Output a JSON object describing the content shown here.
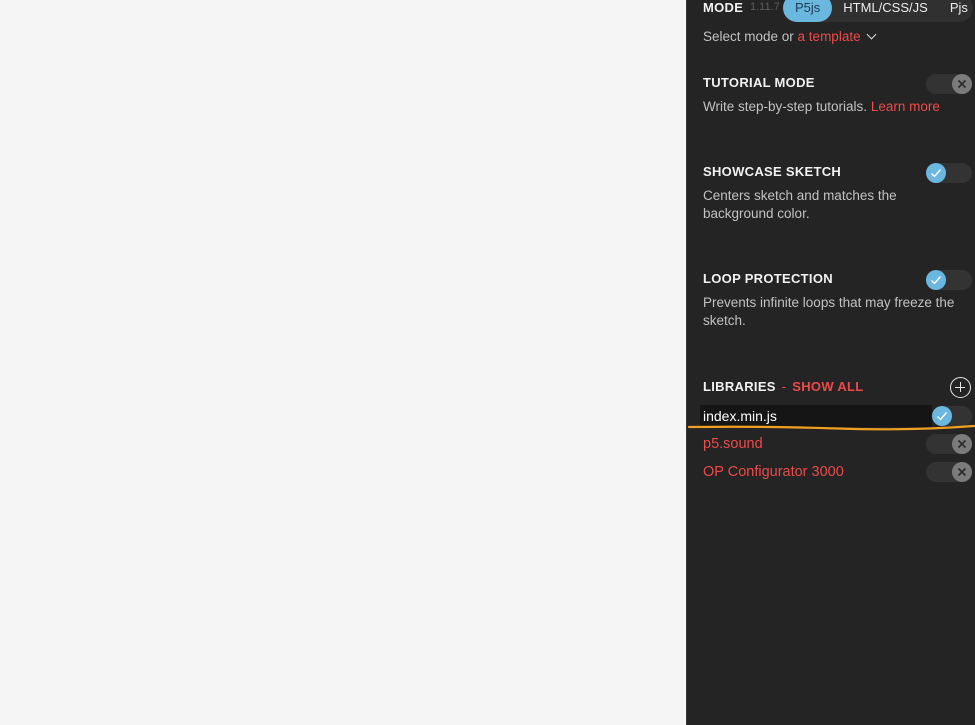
{
  "mode": {
    "title": "MODE",
    "version": "1.11.7",
    "options": [
      "P5js",
      "HTML/CSS/JS",
      "Pjs"
    ],
    "selected": "P5js",
    "subtitle_prefix": "Select mode or ",
    "subtitle_link": "a template"
  },
  "tutorial": {
    "title": "TUTORIAL MODE",
    "desc_prefix": "Write step-by-step tutorials. ",
    "desc_link": "Learn more",
    "enabled": false
  },
  "showcase": {
    "title": "SHOWCASE SKETCH",
    "desc": "Centers sketch and matches the background color.",
    "enabled": true
  },
  "loop": {
    "title": "LOOP PROTECTION",
    "desc": "Prevents infinite loops that may freeze the sketch.",
    "enabled": true
  },
  "libraries": {
    "title": "LIBRARIES",
    "separator": "-",
    "show_all": "SHOW ALL",
    "items": [
      {
        "name": "index.min.js",
        "enabled": true
      },
      {
        "name": "p5.sound",
        "enabled": false
      },
      {
        "name": "OP Configurator 3000",
        "enabled": false
      }
    ]
  },
  "colors": {
    "panel_bg": "#242424",
    "accent_blue": "#6ab7e0",
    "accent_red": "#ed4a4a",
    "highlight_orange": "#f0a020"
  },
  "icons": {
    "check": "check-icon",
    "close": "close-icon",
    "add": "plus-circle-icon",
    "chevron": "chevron-down-icon"
  }
}
